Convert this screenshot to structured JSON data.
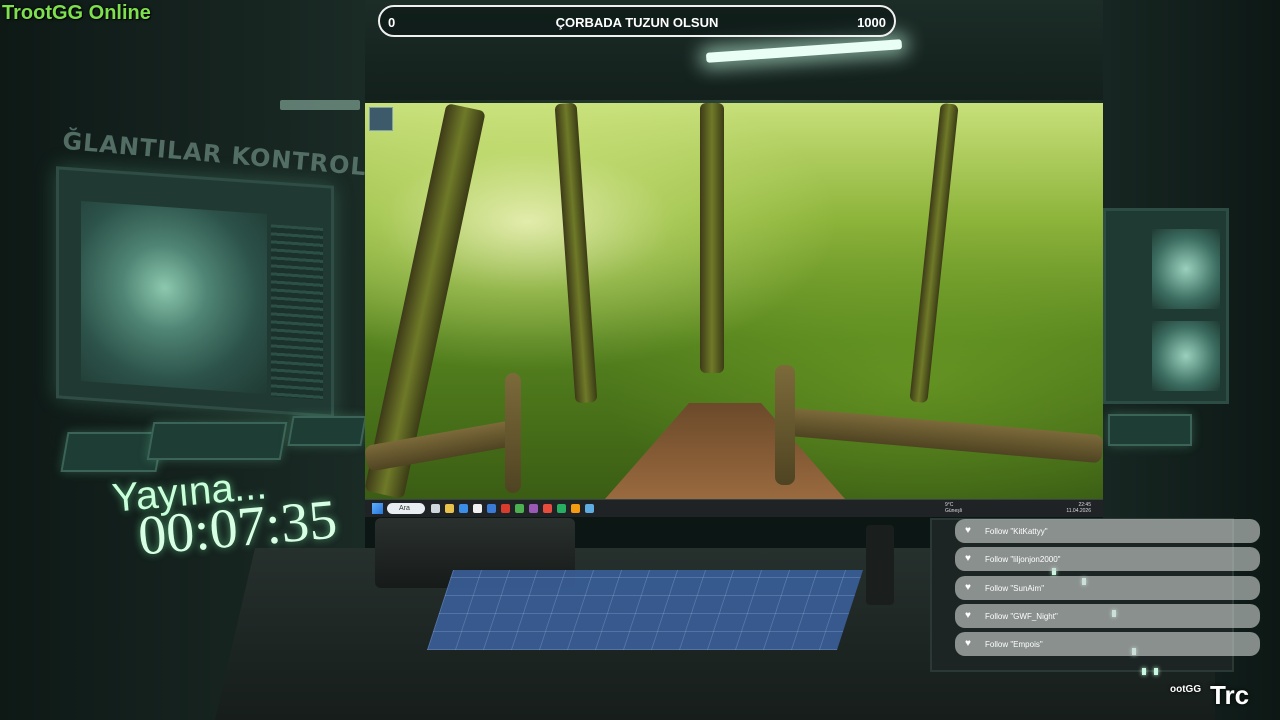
{
  "brand": {
    "name": "TrootGG Online",
    "color": "#7ee04e"
  },
  "wall_text": "ĞLANTILAR KONTROL",
  "goal": {
    "min": "0",
    "title": "ÇORBADA TUZUN OLSUN",
    "max": "1000"
  },
  "desktop": {
    "search_label": "Ara",
    "weather": {
      "temp": "9°C",
      "desc": "Güneşli"
    },
    "clock": {
      "time": "22:45",
      "date": "11.04.2026"
    }
  },
  "countdown": {
    "label": "Yayına...",
    "time": "00:07:35"
  },
  "alerts": [
    {
      "text": "Follow \"KitKattyy\""
    },
    {
      "text": "Follow \"liljonjon2000\""
    },
    {
      "text": "Follow \"SunAim\""
    },
    {
      "text": "Follow \"GWF_Night\""
    },
    {
      "text": "Follow \"Empois\""
    }
  ],
  "corner": {
    "small": "ootGG",
    "big": "Trc"
  },
  "icons": [
    "windows-start-icon",
    "search-icon",
    "heart-icon",
    "weather-icon"
  ]
}
